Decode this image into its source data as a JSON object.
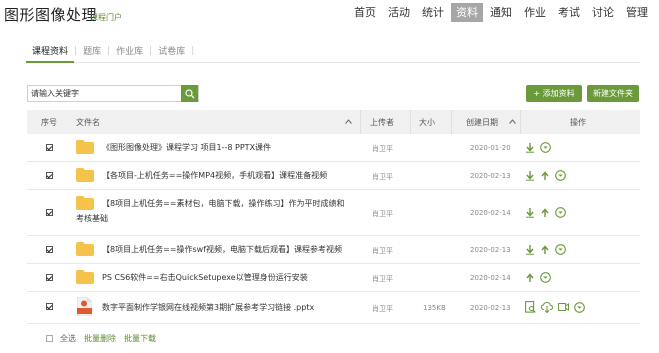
{
  "header": {
    "title": "图形图像处理",
    "subtitle": "课程门户",
    "nav": [
      {
        "label": "首页",
        "active": false
      },
      {
        "label": "活动",
        "active": false
      },
      {
        "label": "统计",
        "active": false
      },
      {
        "label": "资料",
        "active": true
      },
      {
        "label": "通知",
        "active": false
      },
      {
        "label": "作业",
        "active": false
      },
      {
        "label": "考试",
        "active": false
      },
      {
        "label": "讨论",
        "active": false
      },
      {
        "label": "管理",
        "active": false
      }
    ]
  },
  "tabs": [
    "课程资料",
    "题库",
    "作业库",
    "试卷库"
  ],
  "search": {
    "placeholder": "请输入关键字"
  },
  "buttons": {
    "upload": "+ 添加资料",
    "new_folder": "新建文件夹"
  },
  "table": {
    "headers": {
      "index": "序号",
      "filename": "文件名",
      "uploader": "上传者",
      "size": "大小",
      "date": "创建日期",
      "ops": "操作"
    },
    "rows": [
      {
        "name": "《图形图像处理》课程学习 项目1--8 PPTX课件",
        "uploader": "肖卫平",
        "size": "",
        "date": "2020-01-20"
      },
      {
        "name": "【各项目-上机任务==操作MP4视频，手机观看】课程准备视频",
        "uploader": "肖卫平",
        "size": "",
        "date": "2020-02-13"
      },
      {
        "name_line1": "【8项目上机任务==素材包，电脑下载，操作练习】作为平时成绩和",
        "name_line2": "考核基础",
        "uploader": "肖卫平",
        "size": "",
        "date": "2020-02-14"
      },
      {
        "name": "【8项目上机任务==操作swf视频，电脑下载后观看】课程参考视频",
        "uploader": "肖卫平",
        "size": "",
        "date": "2020-02-13"
      },
      {
        "name": "PS CS6软件==右击QuickSetupexe以管理身份运行安装",
        "uploader": "肖卫平",
        "size": "",
        "date": "2020-02-14"
      },
      {
        "name": "数字平面制作学银网在线视频第3期扩展参考学习链接 .pptx",
        "uploader": "肖卫平",
        "size": "135KB",
        "date": "2020-02-13"
      }
    ]
  },
  "footer": {
    "select_all": "全选",
    "batch_delete": "批量删除",
    "batch_download": "批量下载"
  },
  "colors": {
    "accent": "#6a9a3a",
    "folder": "#f5c24b",
    "nav_active": "#a6a6a6"
  }
}
